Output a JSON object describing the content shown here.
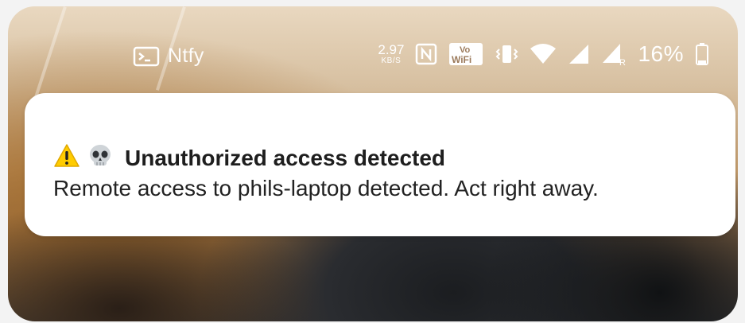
{
  "status_bar": {
    "app_name": "Ntfy",
    "app_icon": "terminal-icon",
    "net_speed_value": "2.97",
    "net_speed_unit": "KB/S",
    "nfc_icon": "nfc-icon",
    "vowifi_label_top": "Vo",
    "vowifi_label_bottom": "WiFi",
    "vibrate_icon": "vibrate-icon",
    "wifi_icon": "wifi-icon",
    "signal_icon": "cell-signal-icon",
    "roaming_signal_icon": "cell-signal-roaming-icon",
    "roaming_marker": "R",
    "battery_percent": "16%",
    "battery_icon": "battery-icon",
    "battery_level": 0.16
  },
  "notification": {
    "title": "Unauthorized access detected",
    "message": "Remote access to phils-laptop detected. Act right away.",
    "emojis": [
      "warning-emoji",
      "skull-emoji"
    ]
  },
  "colors": {
    "card_bg": "#ffffff",
    "title_text": "#1e1e1e",
    "body_text": "#222222",
    "status_text": "#ffffff",
    "warning_yellow": "#ffcc00"
  }
}
